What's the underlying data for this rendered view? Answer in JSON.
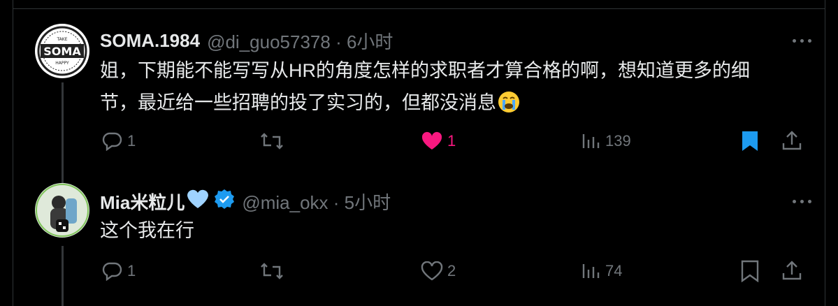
{
  "tweets": [
    {
      "name": "SOMA.1984",
      "handle": "@di_guo57378 · 6小时",
      "avatar_text_top": "TAKE",
      "avatar_text_main": "SOMA",
      "avatar_text_bottom": "HAPPY",
      "text_line1": "姐，下期能不能写写从HR的角度怎样的求职者才算合格的啊，想知道更多的细",
      "text_line2": "节，最近给一些招聘的投了实习的，但都没消息",
      "emoji": "crying-face-emoji",
      "replies": "1",
      "retweets": "",
      "likes": "1",
      "views": "139",
      "liked": true,
      "bookmarked": true
    },
    {
      "name": "Mia米粒儿",
      "handle": "@mia_okx · 5小时",
      "text_line1": "这个我在行",
      "replies": "1",
      "retweets": "",
      "likes": "2",
      "views": "74",
      "liked": false,
      "bookmarked": false,
      "verified": true
    }
  ],
  "colors": {
    "background": "#000000",
    "text": "#e7e9ea",
    "muted": "#71767b",
    "like": "#f91880",
    "bookmark": "#1d9bf0",
    "verified": "#1d9bf0",
    "heart_emoji": "#9fd3ff"
  }
}
